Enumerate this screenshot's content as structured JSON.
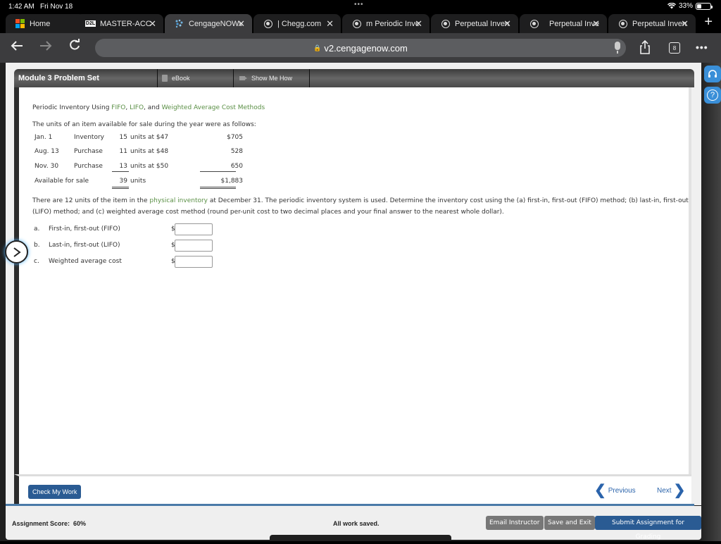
{
  "status_bar": {
    "time": "1:42 AM",
    "date": "Fri Nov 18",
    "battery_percent_label": "33%",
    "battery_level": 0.33
  },
  "browser": {
    "tabs": [
      {
        "label": "Home",
        "icon": "microsoft-logo-icon",
        "active": false,
        "closable": false
      },
      {
        "label": "MASTER-ACC-",
        "icon": "d2l-icon",
        "active": false,
        "closable": true
      },
      {
        "label": "CengageNOWv",
        "icon": "cengage-icon",
        "active": true,
        "closable": true
      },
      {
        "label": "| Chegg.com",
        "icon": "globe-icon",
        "active": false,
        "closable": true
      },
      {
        "label": "m Periodic Inve",
        "icon": "globe-icon",
        "active": false,
        "closable": true
      },
      {
        "label": "Perpetual Inven",
        "icon": "globe-icon",
        "active": false,
        "closable": true
      },
      {
        "label": "Perpetual Inve",
        "icon": "globe-icon",
        "active": false,
        "closable": true
      },
      {
        "label": "Perpetual Inven",
        "icon": "globe-icon",
        "active": false,
        "closable": true
      }
    ],
    "close_glyph": "✕",
    "new_tab_glyph": "+",
    "url": "v2.cengagenow.com",
    "tab_count": "8"
  },
  "module_bar": {
    "title": "Module 3 Problem Set",
    "ebook_label": "eBook",
    "show_me_how_label": "Show Me How"
  },
  "problem": {
    "heading_prefix": "Periodic Inventory Using ",
    "heading_fifo": "FIFO",
    "heading_sep1": ", ",
    "heading_lifo": "LIFO",
    "heading_sep2": ", and ",
    "heading_wac": "Weighted Average Cost Methods",
    "intro": "The units of an item available for sale during the year were as follows:",
    "inventory_rows": [
      {
        "date": "Jan. 1",
        "type": "Inventory",
        "units": "15",
        "at": "units at $47",
        "amount": "$705"
      },
      {
        "date": "Aug. 13",
        "type": "Purchase",
        "units": "11",
        "at": "units at $48",
        "amount": "528"
      },
      {
        "date": "Nov. 30",
        "type": "Purchase",
        "units": "13",
        "at": "units at $50",
        "amount": "650"
      }
    ],
    "total_row": {
      "label": "Available for sale",
      "units": "39",
      "units_suffix": "units",
      "amount": "$1,883"
    },
    "para_part1": "There are 12 units of the item in the ",
    "para_link": "physical inventory",
    "para_part2": " at December 31. The periodic inventory system is used. Determine the inventory cost using the (a) first-in, first-out (FIFO) method; (b) last-in, first-out (LIFO) method; and (c) weighted average cost method (round per-unit cost to two decimal places and your final answer to the nearest whole dollar).",
    "questions": [
      {
        "letter": "a.",
        "label": "First-in, first-out (FIFO)",
        "currency": "$",
        "value": ""
      },
      {
        "letter": "b.",
        "label": "Last-in, first-out (LIFO)",
        "currency": "$",
        "value": ""
      },
      {
        "letter": "c.",
        "label": "Weighted average cost",
        "currency": "$",
        "value": ""
      }
    ]
  },
  "footer": {
    "check_my_work": "Check My Work",
    "previous": "Previous",
    "next": "Next"
  },
  "score_bar": {
    "score_label": "Assignment Score:",
    "score_value": "60%",
    "saved_status": "All work saved.",
    "email_instructor": "Email Instructor",
    "save_and_exit": "Save and Exit",
    "submit": "Submit Assignment for Grading"
  },
  "side_buttons": {
    "help_glyph": "?"
  },
  "colors": {
    "link_green": "#5a8f45",
    "primary_blue": "#2a5b93",
    "nav_blue": "#2a63ab",
    "side_button_blue": "#3a8fd8"
  }
}
